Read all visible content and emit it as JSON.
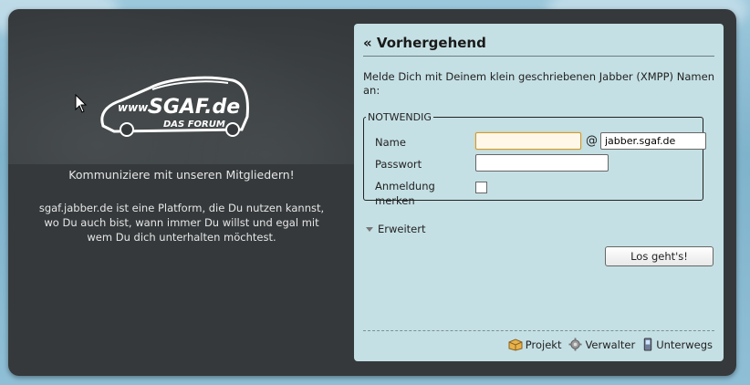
{
  "left": {
    "logo_text": "www.SGAF.de DAS FORUM",
    "tagline": "Kommuniziere mit unseren Mitgliedern!",
    "description": "sgaf.jabber.de ist eine Platform, die Du nutzen kannst, wo Du auch bist, wann immer Du willst und egal mit wem Du dich unterhalten möchtest."
  },
  "panel": {
    "title": "« Vorhergehend",
    "intro": "Melde Dich mit Deinem klein geschriebenen Jabber (XMPP) Namen an:",
    "fieldset_legend": "NOTWENDIG",
    "name_label": "Name",
    "name_value": "",
    "at_sign": "@",
    "domain_value": "jabber.sgaf.de",
    "password_label": "Passwort",
    "password_value": "",
    "remember_label_1": "Anmeldung",
    "remember_label_2": "merken",
    "remember_checked": false,
    "advanced_label": "Erweitert",
    "submit_label": "Los geht's!"
  },
  "footer": {
    "links": [
      {
        "label": "Projekt",
        "icon": "box-icon"
      },
      {
        "label": "Verwalter",
        "icon": "gear-icon"
      },
      {
        "label": "Unterwegs",
        "icon": "phone-icon"
      }
    ]
  },
  "colors": {
    "frame_bg": "#35393b",
    "panel_bg": "#c5e0e4",
    "sky": "#8fbfd6",
    "focus_border": "#c89a3c"
  }
}
